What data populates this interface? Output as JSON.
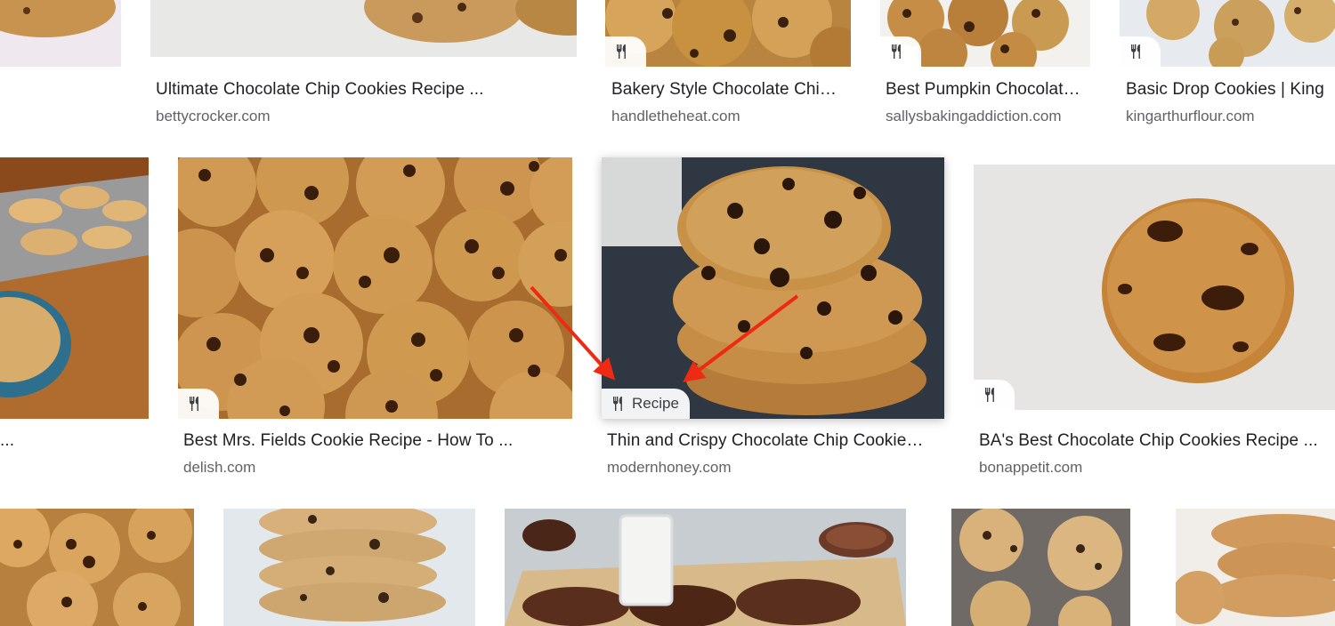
{
  "badge_icon": "fork-knife-icon",
  "recipe_label": "Recipe",
  "arrow_color": "#ee2a12",
  "results": [
    {
      "title": "",
      "source": ""
    },
    {
      "title": "Ultimate Chocolate Chip Cookies Recipe ...",
      "source": "bettycrocker.com"
    },
    {
      "title": "Bakery Style Chocolate Chi…",
      "source": "handletheheat.com"
    },
    {
      "title": "Best Pumpkin Chocolat…",
      "source": "sallysbakingaddiction.com"
    },
    {
      "title": "Basic Drop Cookies | King",
      "source": "kingarthurflour.com"
    },
    {
      "title": "...",
      "source": ""
    },
    {
      "title": "Best Mrs. Fields Cookie Recipe - How To ...",
      "source": "delish.com"
    },
    {
      "title": "Thin and Crispy Chocolate Chip Cookie…",
      "source": "modernhoney.com"
    },
    {
      "title": "BA's Best Chocolate Chip Cookies Recipe ...",
      "source": "bonappetit.com"
    },
    {
      "title": "",
      "source": ""
    },
    {
      "title": "",
      "source": ""
    },
    {
      "title": "",
      "source": ""
    },
    {
      "title": "",
      "source": ""
    },
    {
      "title": "",
      "source": ""
    }
  ]
}
